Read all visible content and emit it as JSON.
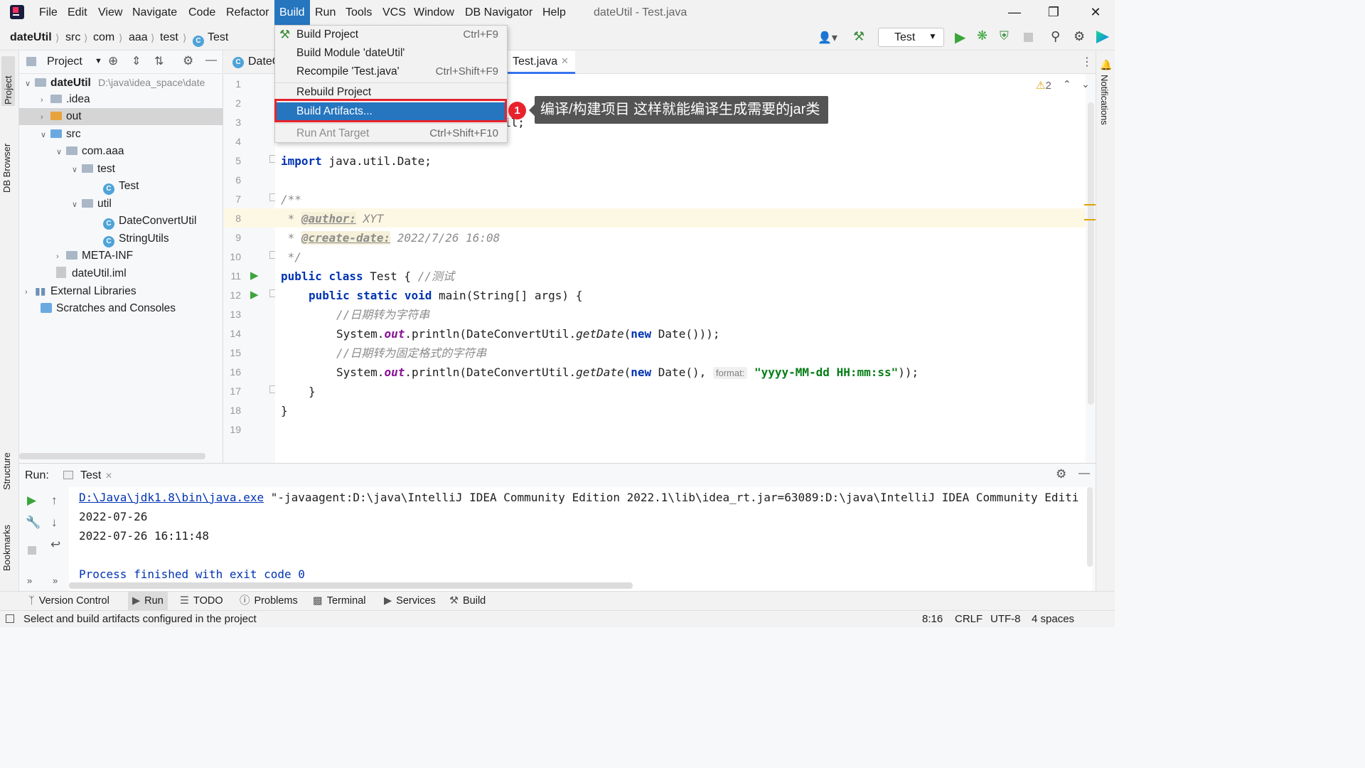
{
  "window": {
    "title": "dateUtil - Test.java"
  },
  "menu": {
    "items": [
      "File",
      "Edit",
      "View",
      "Navigate",
      "Code",
      "Refactor",
      "Build",
      "Run",
      "Tools",
      "VCS",
      "Window",
      "DB Navigator",
      "Help"
    ],
    "active": "Build"
  },
  "breadcrumb": [
    "dateUtil",
    "src",
    "com",
    "aaa",
    "test",
    "Test"
  ],
  "run_config": "Test",
  "left_stripe": [
    "Project",
    "DB Browser",
    "Structure",
    "Bookmarks"
  ],
  "right_stripe": [
    "Notifications"
  ],
  "project": {
    "header": "Project",
    "root_name": "dateUtil",
    "root_path": "D:\\java\\idea_space\\date",
    "tree": [
      "dateUtil",
      ".idea",
      "out",
      "src",
      "com.aaa",
      "test",
      "Test",
      "util",
      "DateConvertUtil",
      "StringUtils",
      "META-INF",
      "dateUtil.iml",
      "External Libraries",
      "Scratches and Consoles"
    ]
  },
  "editor": {
    "tabs": [
      "DateC",
      "Test.java"
    ],
    "warnings": "2",
    "line_numbers": [
      "1",
      "2",
      "3",
      "4",
      "5",
      "6",
      "7",
      "8",
      "9",
      "10",
      "11",
      "12",
      "13",
      "14",
      "15",
      "16",
      "17",
      "18",
      "19"
    ],
    "code": {
      "l3_tail": "il;",
      "l5_kw": "import",
      "l5_rest": " java.util.Date;",
      "l7": "/**",
      "l8_star": " * ",
      "l8_tag": "@author:",
      "l8_val": " XYT",
      "l9_star": " * ",
      "l9_tag": "@create-date:",
      "l9_val": " 2022/7/26 16:08",
      "l10": " */",
      "l11_kw1": "public",
      "l11_kw2": "class",
      "l11_rest": " Test { ",
      "l11_cm": "//测试",
      "l12_kw1": "public",
      "l12_kw2": "static",
      "l12_kw3": "void",
      "l12_rest": " main(String[] args) {",
      "l13_cm": "//日期转为字符串",
      "l14_a": "System.",
      "l14_out": "out",
      "l14_b": ".println(DateConvertUtil.",
      "l14_m": "getDate",
      "l14_c": "(",
      "l14_new": "new",
      "l14_d": " Date()));",
      "l15_cm": "//日期转为固定格式的字符串",
      "l16_a": "System.",
      "l16_out": "out",
      "l16_b": ".println(DateConvertUtil.",
      "l16_m": "getDate",
      "l16_c": "(",
      "l16_new": "new",
      "l16_d": " Date(), ",
      "l16_hint": "format:",
      "l16_str": "\"yyyy-MM-dd HH:mm:ss\"",
      "l16_e": "));",
      "l17": "}",
      "l18": "}"
    }
  },
  "build_menu": {
    "items": [
      {
        "label": "Build Project",
        "shortcut": "Ctrl+F9"
      },
      {
        "label": "Build Module 'dateUtil'",
        "shortcut": ""
      },
      {
        "label": "Recompile 'Test.java'",
        "shortcut": "Ctrl+Shift+F9"
      },
      {
        "label": "Rebuild Project",
        "shortcut": ""
      },
      {
        "label": "Build Artifacts...",
        "shortcut": ""
      },
      {
        "label": "Run Ant Target",
        "shortcut": "Ctrl+Shift+F10"
      }
    ],
    "highlighted": "Build Artifacts..."
  },
  "annotation": {
    "badge": "1",
    "text": "编译/构建项目 这样就能编译生成需要的jar类"
  },
  "run_panel": {
    "label": "Run:",
    "tab": "Test",
    "console": {
      "line1_link": "D:\\Java\\jdk1.8\\bin\\java.exe",
      "line1_rest": " \"-javaagent:D:\\java\\IntelliJ IDEA Community Edition 2022.1\\lib\\idea_rt.jar=63089:D:\\java\\IntelliJ IDEA Community Editi",
      "line2": "2022-07-26",
      "line3": "2022-07-26 16:11:48",
      "line5": "Process finished with exit code 0"
    }
  },
  "bottom_tabs": [
    "Version Control",
    "Run",
    "TODO",
    "Problems",
    "Terminal",
    "Services",
    "Build"
  ],
  "status": {
    "message": "Select and build artifacts configured in the project",
    "position": "8:16",
    "line_sep": "CRLF",
    "encoding": "UTF-8",
    "indent": "4 spaces"
  },
  "colors": {
    "accent": "#2675bf",
    "annotation_red": "#e8232c",
    "callout_bg": "#545454"
  }
}
